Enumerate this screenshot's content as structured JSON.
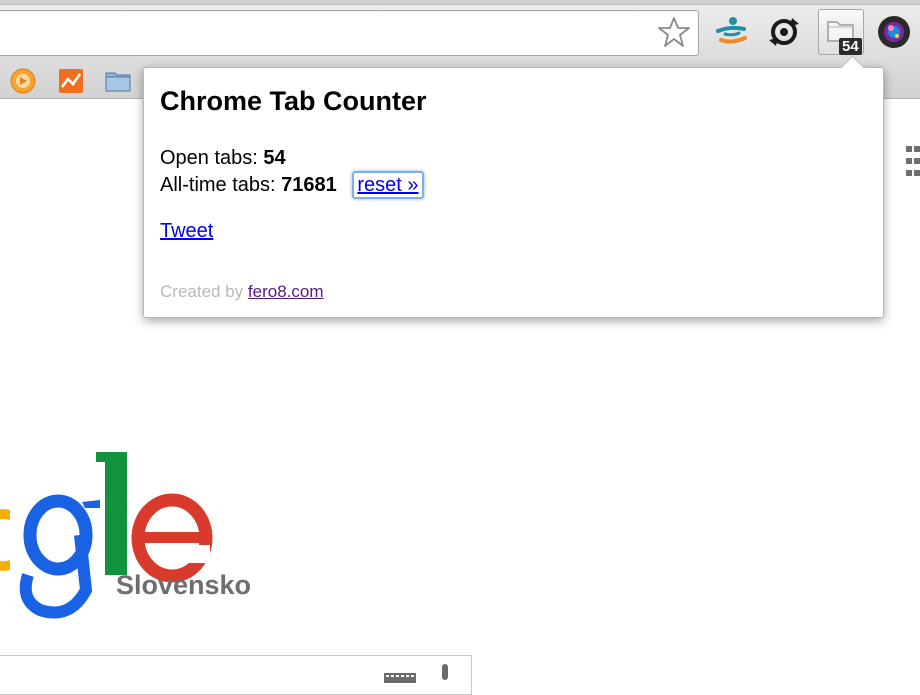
{
  "browser": {
    "extension_badge": "54",
    "icons": {
      "bookmark_star": "star-icon",
      "extensions": [
        "person-swoosh-icon",
        "sync-icon",
        "tab-counter-icon",
        "camera-lens-icon"
      ],
      "bookmarks": [
        "circular-app-icon",
        "analytics-chart-icon",
        "folder-icon"
      ]
    }
  },
  "popup": {
    "title": "Chrome Tab Counter",
    "open_tabs_label": "Open tabs:",
    "open_tabs_value": "54",
    "alltime_tabs_label": "All-time tabs:",
    "alltime_tabs_value": "71681",
    "reset_label": "reset »",
    "tweet_label": "Tweet",
    "credit_prefix": "Created by",
    "credit_link": "fero8.com"
  },
  "page": {
    "logo_text": "ogle",
    "logo_region": "Slovensko",
    "colors": {
      "google_blue": "#1a62e4",
      "google_red": "#d83b2b",
      "google_yellow": "#f3b000",
      "google_green": "#14933f",
      "link": "#0000ee",
      "visited_link": "#551a8b"
    }
  }
}
